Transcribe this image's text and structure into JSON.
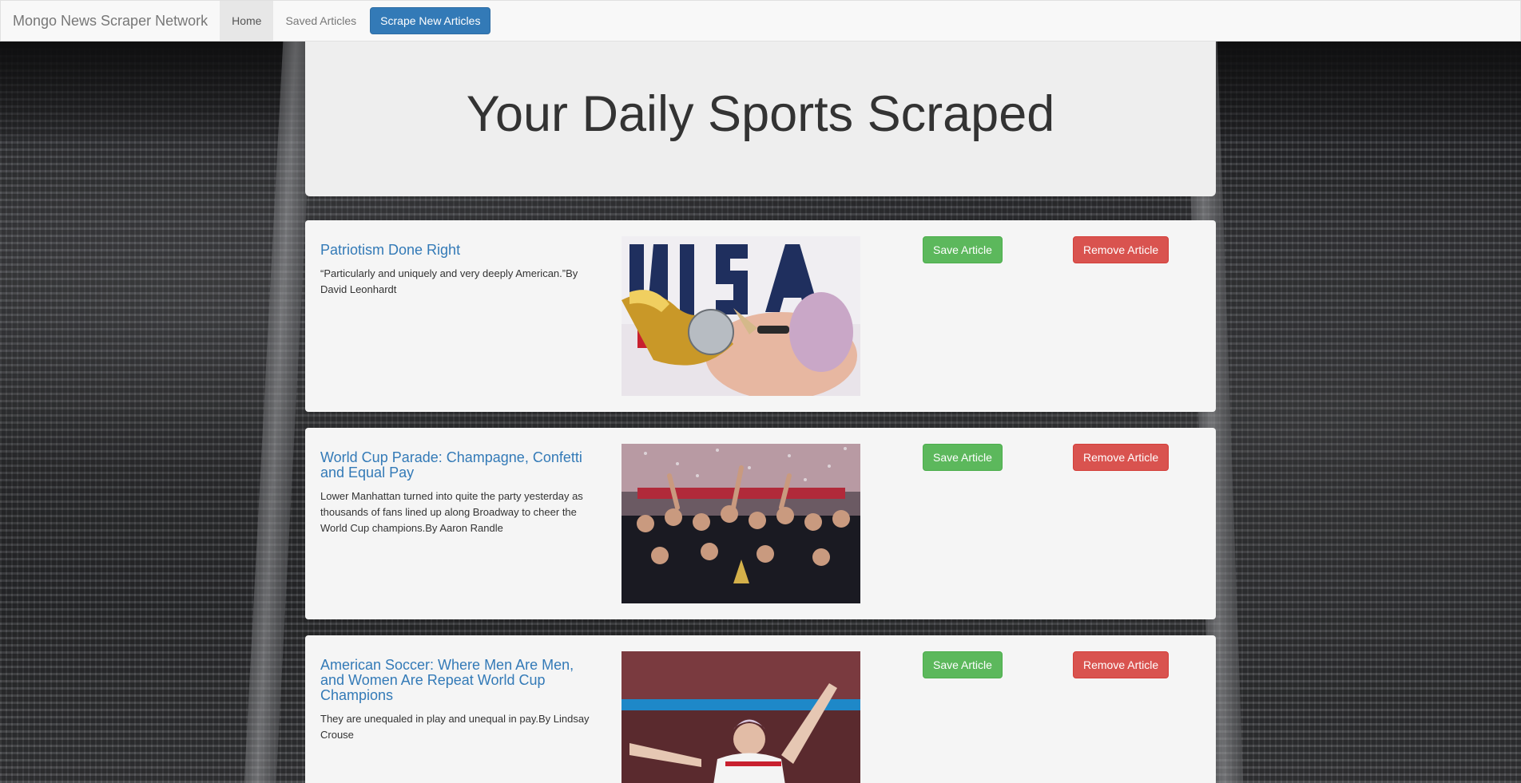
{
  "navbar": {
    "brand": "Mongo News Scraper Network",
    "links": [
      {
        "label": "Home",
        "active": true
      },
      {
        "label": "Saved Articles",
        "active": false
      }
    ],
    "scrape_button": "Scrape New Articles"
  },
  "jumbotron": {
    "title": "Your Daily Sports Scraped"
  },
  "articles": [
    {
      "title": "Patriotism Done Right",
      "summary": "“Particularly and uniquely and very deeply American.”By David Leonhardt",
      "save_label": "Save Article",
      "remove_label": "Remove Article"
    },
    {
      "title": "World Cup Parade: Champagne, Confetti and Equal Pay",
      "summary": "Lower Manhattan turned into quite the party yesterday as thousands of fans lined up along Broadway to cheer the World Cup champions.By Aaron Randle",
      "save_label": "Save Article",
      "remove_label": "Remove Article"
    },
    {
      "title": "American Soccer: Where Men Are Men, and Women Are Repeat World Cup Champions",
      "summary": "They are unequaled in play and unequal in pay.By Lindsay Crouse",
      "save_label": "Save Article",
      "remove_label": "Remove Article"
    }
  ],
  "colors": {
    "primary": "#337ab7",
    "success": "#5cb85c",
    "danger": "#d9534f",
    "navbar_bg": "#f8f8f8",
    "jumbotron_bg": "#eeeeee",
    "panel_bg": "#f5f5f5"
  }
}
